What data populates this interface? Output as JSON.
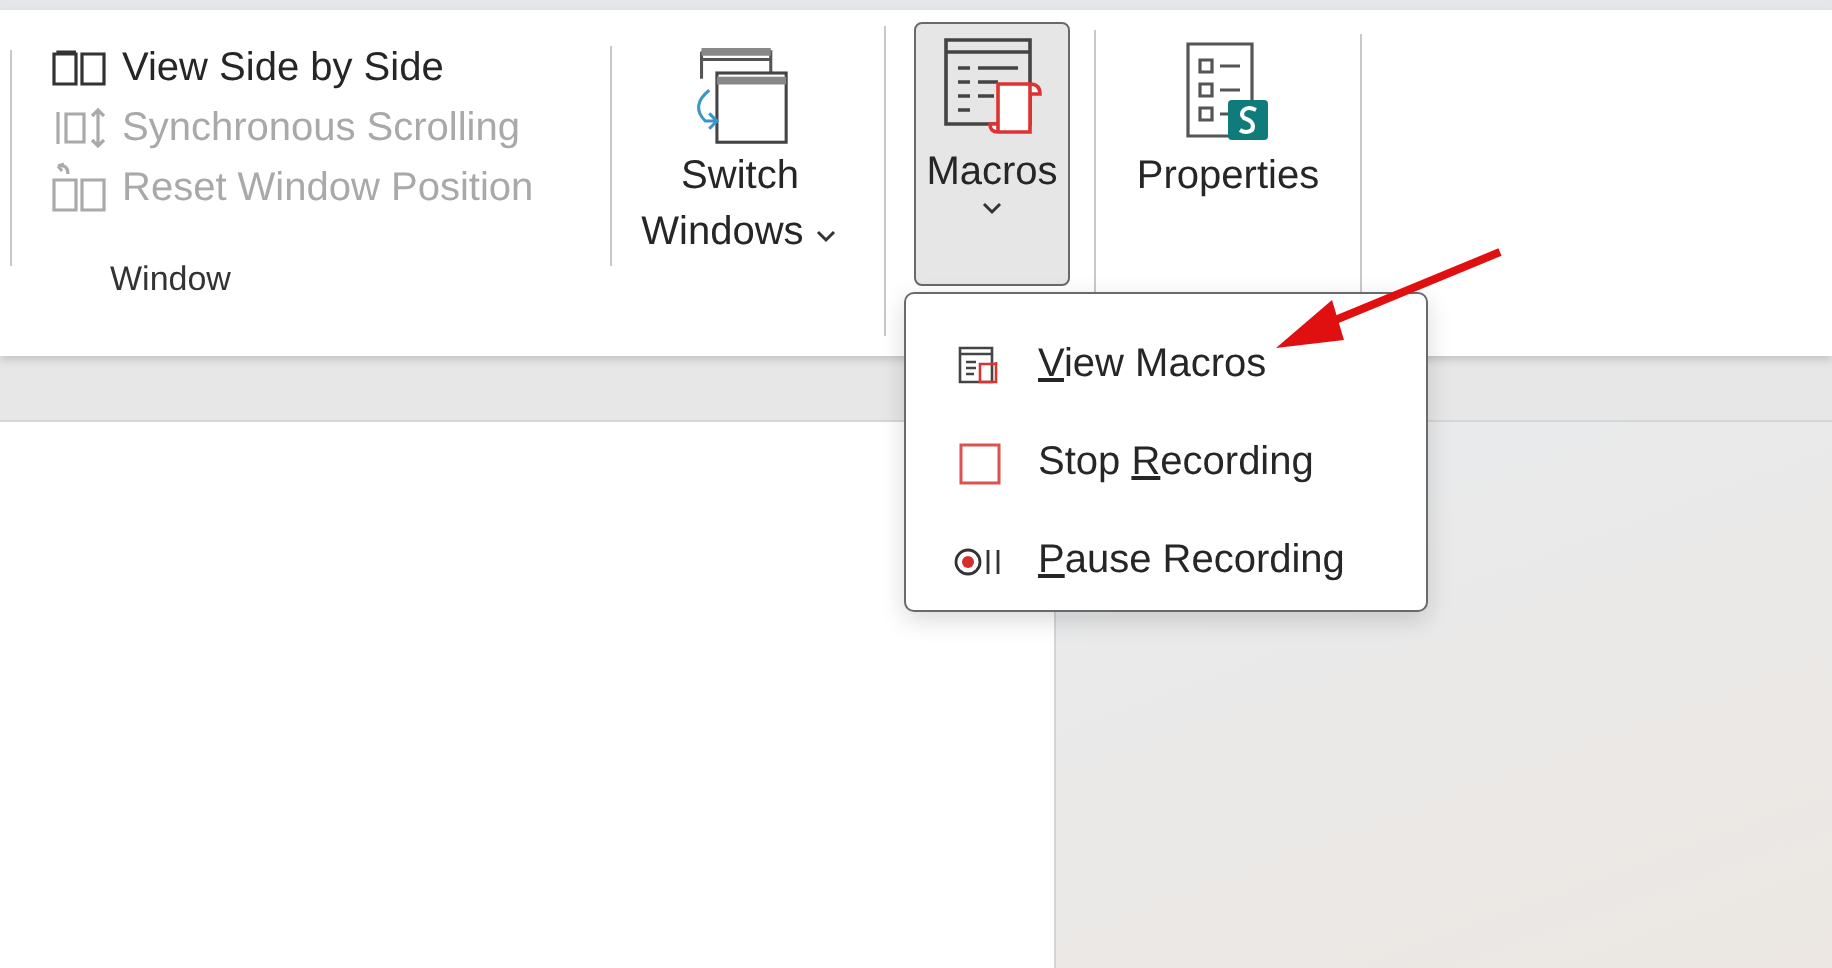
{
  "window_group": {
    "label": "Window",
    "commands": [
      {
        "label": "View Side by Side",
        "disabled": false,
        "kind": "side"
      },
      {
        "label": "Synchronous Scrolling",
        "disabled": true,
        "kind": "sync"
      },
      {
        "label": "Reset Window Position",
        "disabled": true,
        "kind": "reset"
      }
    ],
    "switch_windows": {
      "line1": "Switch",
      "line2": "Windows"
    }
  },
  "macros_button": {
    "label": "Macros",
    "expanded": true
  },
  "properties_button": {
    "label": "Properties"
  },
  "macros_menu": [
    {
      "kind": "view",
      "key": "V",
      "after": "iew Macros"
    },
    {
      "kind": "stop",
      "before": "Stop ",
      "key": "R",
      "after": "ecording"
    },
    {
      "kind": "pause",
      "key": "P",
      "after": "ause Recording"
    }
  ]
}
